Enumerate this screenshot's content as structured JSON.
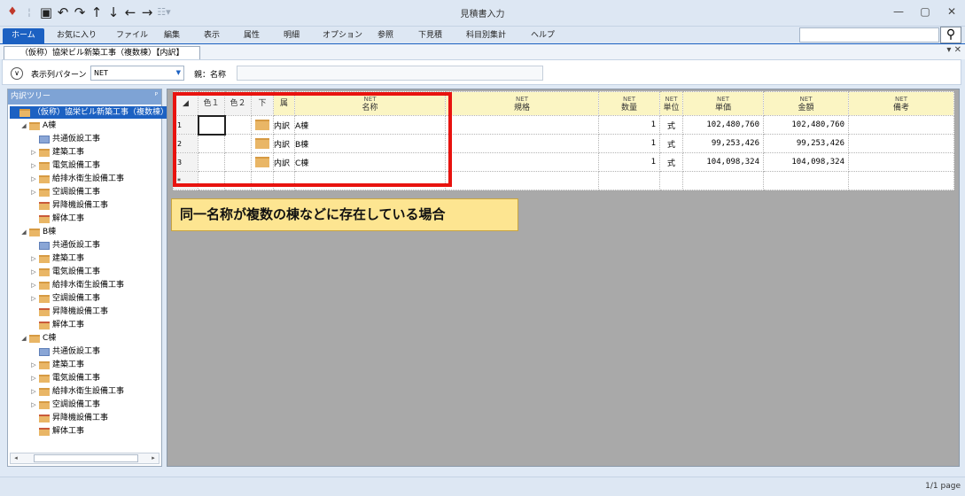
{
  "window": {
    "title": "見積書入力"
  },
  "quick_access": {
    "icons": [
      "app-icon",
      "save-icon",
      "undo-icon",
      "redo-icon",
      "arrow-up-icon",
      "arrow-down-icon",
      "arrow-left-icon",
      "arrow-right-icon",
      "customize-icon"
    ]
  },
  "menu": {
    "items": [
      "ホーム",
      "お気に入り",
      "ファイル",
      "編集",
      "表示",
      "属性",
      "明細",
      "オプション",
      "参照",
      "下見積",
      "科目別集計",
      "ヘルプ"
    ]
  },
  "search": {
    "value": ""
  },
  "doc_tab": {
    "label": "（仮称）協栄ビル新築工事（複数棟）【内訳】"
  },
  "toolbar": {
    "pattern_label": "表示列パターン",
    "pattern_value": "NET",
    "parent_label": "親：名称",
    "parent_value": ""
  },
  "tree": {
    "title": "内訳ツリー",
    "nodes": [
      {
        "label": "（仮称）協栄ビル新築工事（複数棟）",
        "level": 0,
        "icon": "folder",
        "toggle": "",
        "selected": true
      },
      {
        "label": "A棟",
        "level": 1,
        "icon": "folder",
        "toggle": "◢"
      },
      {
        "label": "共通仮設工事",
        "level": 2,
        "icon": "doc",
        "toggle": ""
      },
      {
        "label": "建築工事",
        "level": 2,
        "icon": "folder",
        "toggle": "▷"
      },
      {
        "label": "電気設備工事",
        "level": 2,
        "icon": "folder",
        "toggle": "▷"
      },
      {
        "label": "給排水衛生設備工事",
        "level": 2,
        "icon": "folder",
        "toggle": "▷"
      },
      {
        "label": "空調設備工事",
        "level": 2,
        "icon": "folder",
        "toggle": "▷"
      },
      {
        "label": "昇降機設備工事",
        "level": 2,
        "icon": "folderx",
        "toggle": ""
      },
      {
        "label": "解体工事",
        "level": 2,
        "icon": "folderx",
        "toggle": ""
      },
      {
        "label": "B棟",
        "level": 1,
        "icon": "folder",
        "toggle": "◢"
      },
      {
        "label": "共通仮設工事",
        "level": 2,
        "icon": "doc",
        "toggle": ""
      },
      {
        "label": "建築工事",
        "level": 2,
        "icon": "folder",
        "toggle": "▷"
      },
      {
        "label": "電気設備工事",
        "level": 2,
        "icon": "folder",
        "toggle": "▷"
      },
      {
        "label": "給排水衛生設備工事",
        "level": 2,
        "icon": "folder",
        "toggle": "▷"
      },
      {
        "label": "空調設備工事",
        "level": 2,
        "icon": "folder",
        "toggle": "▷"
      },
      {
        "label": "昇降機設備工事",
        "level": 2,
        "icon": "folderx",
        "toggle": ""
      },
      {
        "label": "解体工事",
        "level": 2,
        "icon": "folderx",
        "toggle": ""
      },
      {
        "label": "C棟",
        "level": 1,
        "icon": "folder",
        "toggle": "◢"
      },
      {
        "label": "共通仮設工事",
        "level": 2,
        "icon": "doc",
        "toggle": ""
      },
      {
        "label": "建築工事",
        "level": 2,
        "icon": "folder",
        "toggle": "▷"
      },
      {
        "label": "電気設備工事",
        "level": 2,
        "icon": "folder",
        "toggle": "▷"
      },
      {
        "label": "給排水衛生設備工事",
        "level": 2,
        "icon": "folder",
        "toggle": "▷"
      },
      {
        "label": "空調設備工事",
        "level": 2,
        "icon": "folder",
        "toggle": "▷"
      },
      {
        "label": "昇降機設備工事",
        "level": 2,
        "icon": "folderx",
        "toggle": ""
      },
      {
        "label": "解体工事",
        "level": 2,
        "icon": "folderx",
        "toggle": ""
      }
    ]
  },
  "grid": {
    "header": {
      "color1": "色１",
      "color2": "色２",
      "down": "下",
      "attr": "属",
      "name": {
        "net": "NET",
        "label": "名称"
      },
      "spec": {
        "net": "NET",
        "label": "規格"
      },
      "qty": {
        "net": "NET",
        "label": "数量"
      },
      "unit": {
        "net": "NET",
        "label": "単位"
      },
      "price": {
        "net": "NET",
        "label": "単価"
      },
      "amount": {
        "net": "NET",
        "label": "金額"
      },
      "note": {
        "net": "NET",
        "label": "備考"
      }
    },
    "rows": [
      {
        "no": "1",
        "attr": "内訳",
        "name": "A棟",
        "spec": "",
        "qty": "1",
        "unit": "式",
        "price": "102,480,760",
        "amount": "102,480,760",
        "note": ""
      },
      {
        "no": "2",
        "attr": "内訳",
        "name": "B棟",
        "spec": "",
        "qty": "1",
        "unit": "式",
        "price": "99,253,426",
        "amount": "99,253,426",
        "note": ""
      },
      {
        "no": "3",
        "attr": "内訳",
        "name": "C棟",
        "spec": "",
        "qty": "1",
        "unit": "式",
        "price": "104,098,324",
        "amount": "104,098,324",
        "note": ""
      }
    ],
    "new_row_marker": "*"
  },
  "callout": {
    "text": "同一名称が複数の棟などに存在している場合"
  },
  "status": {
    "page": "1/1 page"
  },
  "colors": {
    "accent": "#1c61c2",
    "highlight": "#e8130f",
    "callout_bg": "#fde591",
    "header_bg": "#fbf5c3"
  }
}
